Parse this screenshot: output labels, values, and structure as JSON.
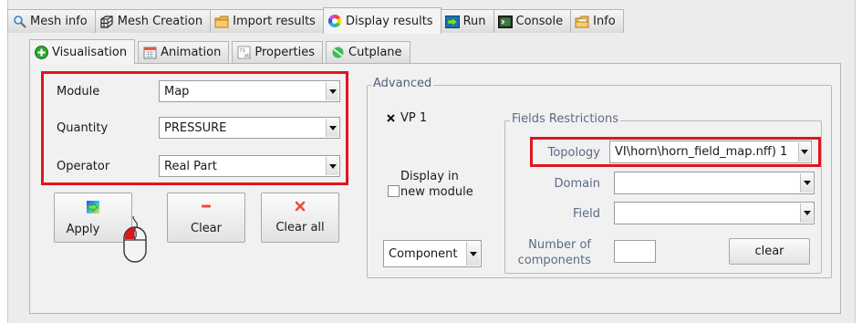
{
  "tabs": [
    {
      "label": "Mesh info",
      "icon": "magnifier-icon"
    },
    {
      "label": "Mesh Creation",
      "icon": "mesh-icon"
    },
    {
      "label": "Import results",
      "icon": "folder-icon"
    },
    {
      "label": "Display results",
      "icon": "color-wheel-icon"
    },
    {
      "label": "Run",
      "icon": "run-arrow-icon"
    },
    {
      "label": "Console",
      "icon": "console-icon"
    },
    {
      "label": "Info",
      "icon": "info-folder-icon"
    }
  ],
  "active_tab": "Display results",
  "subtabs": [
    {
      "label": "Visualisation",
      "icon": "green-plus-icon"
    },
    {
      "label": "Animation",
      "icon": "calendar-icon"
    },
    {
      "label": "Properties",
      "icon": "properties-icon"
    },
    {
      "label": "Cutplane",
      "icon": "cutplane-icon"
    }
  ],
  "active_subtab": "Visualisation",
  "fields": {
    "module": {
      "label": "Module",
      "value": "Map"
    },
    "quantity": {
      "label": "Quantity",
      "value": "PRESSURE"
    },
    "operator": {
      "label": "Operator",
      "value": "Real Part"
    }
  },
  "buttons": {
    "apply": "Apply",
    "clear": "Clear",
    "clear_all": "Clear all"
  },
  "advanced": {
    "title": "Advanced",
    "vp_label": "VP 1",
    "vp_checked": true,
    "display_new_module": "Display in new module",
    "display_new_module_line1": "Display in",
    "display_new_module_line2": "new module",
    "component_select": "Component"
  },
  "restrictions": {
    "title": "Fields Restrictions",
    "topology_label": "Topology",
    "topology_value": "VI\\horn\\horn_field_map.nff) 1",
    "domain_label": "Domain",
    "domain_value": "",
    "field_label": "Field",
    "field_value": "",
    "num_components_line1": "Number of",
    "num_components_line2": "components",
    "num_components_value": "",
    "clear_button": "clear"
  },
  "colors": {
    "highlight": "#e0161d",
    "group_label": "#5a6a86"
  }
}
